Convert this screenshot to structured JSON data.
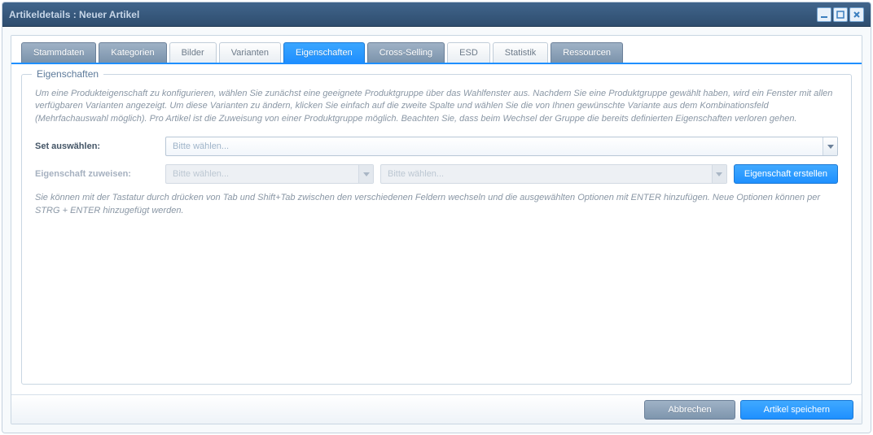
{
  "window": {
    "title": "Artikeldetails : Neuer Artikel"
  },
  "tabs": [
    {
      "label": "Stammdaten"
    },
    {
      "label": "Kategorien"
    },
    {
      "label": "Bilder"
    },
    {
      "label": "Varianten"
    },
    {
      "label": "Eigenschaften"
    },
    {
      "label": "Cross-Selling"
    },
    {
      "label": "ESD"
    },
    {
      "label": "Statistik"
    },
    {
      "label": "Ressourcen"
    }
  ],
  "fieldset": {
    "legend": "Eigenschaften",
    "info": "Um eine Produkteigenschaft zu konfigurieren, wählen Sie zunächst eine geeignete Produktgruppe über das Wahlfenster aus. Nachdem Sie eine Produktgruppe gewählt haben, wird ein Fenster mit allen verfügbaren Varianten angezeigt. Um diese Varianten zu ändern, klicken Sie einfach auf die zweite Spalte und wählen Sie die von Ihnen gewünschte Variante aus dem Kombinationsfeld (Mehrfachauswahl möglich). Pro Artikel ist die Zuweisung von einer Produktgruppe möglich. Beachten Sie, dass beim Wechsel der Gruppe die bereits definierten Eigenschaften verloren gehen.",
    "set_label": "Set auswählen:",
    "set_placeholder": "Bitte wählen...",
    "assign_label": "Eigenschaft zuweisen:",
    "assign_placeholder1": "Bitte wählen...",
    "assign_placeholder2": "Bitte wählen...",
    "create_button": "Eigenschaft erstellen",
    "hint": "Sie können mit der Tastatur durch drücken von Tab und Shift+Tab zwischen den verschiedenen Feldern wechseln und die ausgewählten Optionen mit ENTER hinzufügen. Neue Optionen können per STRG + ENTER hinzugefügt werden."
  },
  "footer": {
    "cancel": "Abbrechen",
    "save": "Artikel speichern"
  }
}
